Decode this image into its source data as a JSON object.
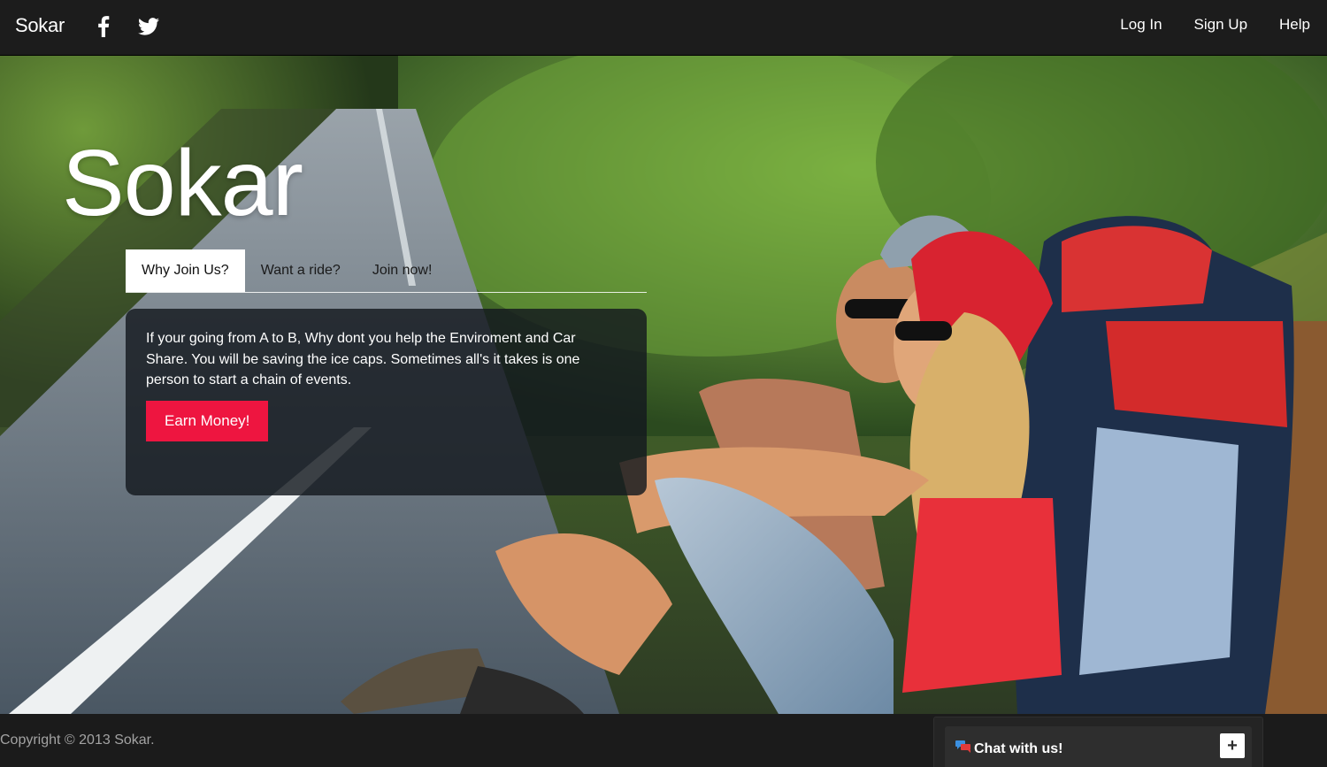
{
  "navbar": {
    "brand": "Sokar",
    "social": [
      {
        "icon": "facebook-icon"
      },
      {
        "icon": "twitter-icon"
      }
    ],
    "links": [
      "Log In",
      "Sign Up",
      "Help"
    ]
  },
  "hero": {
    "title": "Sokar",
    "tabs": [
      "Why Join Us?",
      "Want a ride?",
      "Join now!"
    ],
    "active_tab": "Why Join Us?",
    "panel_text": "If your going from A to B, Why dont you help the Enviroment and Car Share. You will be saving the ice caps. Sometimes all's it takes is one person to start a chain of events.",
    "cta_label": "Earn Money!"
  },
  "footer": {
    "copyright": "Copyright © 2013 Sokar.",
    "chat_label": "Chat with us!",
    "chat_icon": "chat-bubbles-icon",
    "chat_toggle": "+"
  },
  "colors": {
    "navbar_bg": "#1c1c1c",
    "accent": "#ee1540",
    "panel_bg": "rgba(20,24,30,0.82)"
  }
}
